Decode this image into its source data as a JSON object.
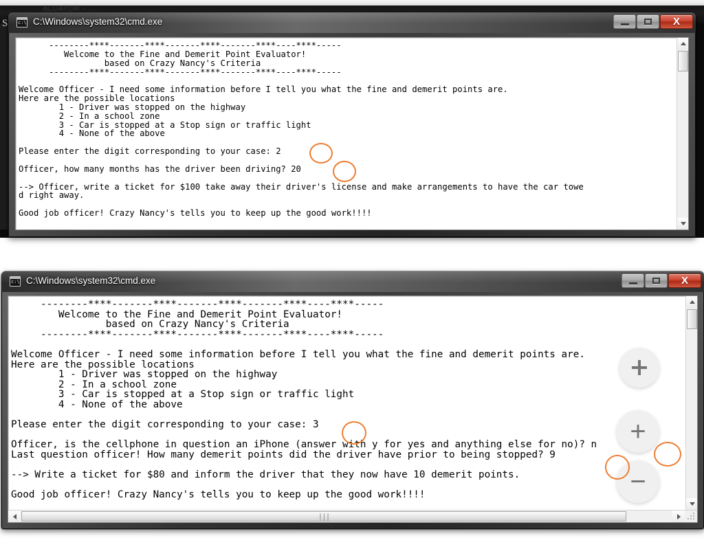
{
  "background": {
    "ghost_text": "ALUATOR  - ...",
    "left_letter": "S"
  },
  "windows": [
    {
      "id": "top",
      "title": "C:\\Windows\\system32\\cmd.exe",
      "icon": "cmd-icon",
      "prompt_glyph": "c:\\",
      "controls": {
        "minimize_label": "Minimize",
        "maximize_label": "Maximize",
        "close_label": "X"
      },
      "console_text": "      --------****-------****-------****-------****----****-----\n         Welcome to the Fine and Demerit Point Evaluator!\n                 based on Crazy Nancy's Criteria\n      --------****-------****-------****-------****----****-----\n\nWelcome Officer - I need some information before I tell you what the fine and demerit points are.\nHere are the possible locations\n        1 - Driver was stopped on the highway\n        2 - In a school zone\n        3 - Car is stopped at a Stop sign or traffic light\n        4 - None of the above\n\nPlease enter the digit corresponding to your case: 2\n\nOfficer, how many months has the driver been driving? 20\n\n--> Officer, write a ticket for $100 take away their driver's license and make arrangements to have the car towe\nd right away.\n\nGood job officer! Crazy Nancy's tells you to keep up the good work!!!!",
      "annotations": [
        {
          "name": "case-answer",
          "value": "2"
        },
        {
          "name": "months-answer",
          "value": "20"
        }
      ]
    },
    {
      "id": "bottom",
      "title": "C:\\Windows\\system32\\cmd.exe",
      "icon": "cmd-icon",
      "prompt_glyph": "c:\\",
      "controls": {
        "minimize_label": "Minimize",
        "maximize_label": "Maximize",
        "close_label": "X"
      },
      "console_text": "     --------****-------****-------****-------****----****-----\n        Welcome to the Fine and Demerit Point Evaluator!\n                based on Crazy Nancy's Criteria\n     --------****-------****-------****-------****----****-----\n\nWelcome Officer - I need some information before I tell you what the fine and demerit points are.\nHere are the possible locations\n        1 - Driver was stopped on the highway\n        2 - In a school zone\n        3 - Car is stopped at a Stop sign or traffic light\n        4 - None of the above\n\nPlease enter the digit corresponding to your case: 3\n\nOfficer, is the cellphone in question an iPhone (answer with y for yes and anything else for no)? n\nLast question officer! How many demerit points did the driver have prior to being stopped? 9\n\n--> Write a ticket for $80 and inform the driver that they now have 10 demerit points.\n\nGood job officer! Crazy Nancy's tells you to keep up the good work!!!!",
      "annotations": [
        {
          "name": "case-answer",
          "value": "3"
        },
        {
          "name": "iphone-answer",
          "value": "n"
        },
        {
          "name": "demerit-answer",
          "value": "9"
        }
      ],
      "overlay_controls": [
        {
          "name": "fit-to-screen",
          "label": ""
        },
        {
          "name": "zoom-in",
          "label": "+"
        },
        {
          "name": "zoom-out",
          "label": "−"
        }
      ]
    }
  ],
  "colors": {
    "annotation": "#ED7D31",
    "console_bg": "#FFFFFF",
    "console_fg": "#000000",
    "close_button": "#C9402C"
  }
}
